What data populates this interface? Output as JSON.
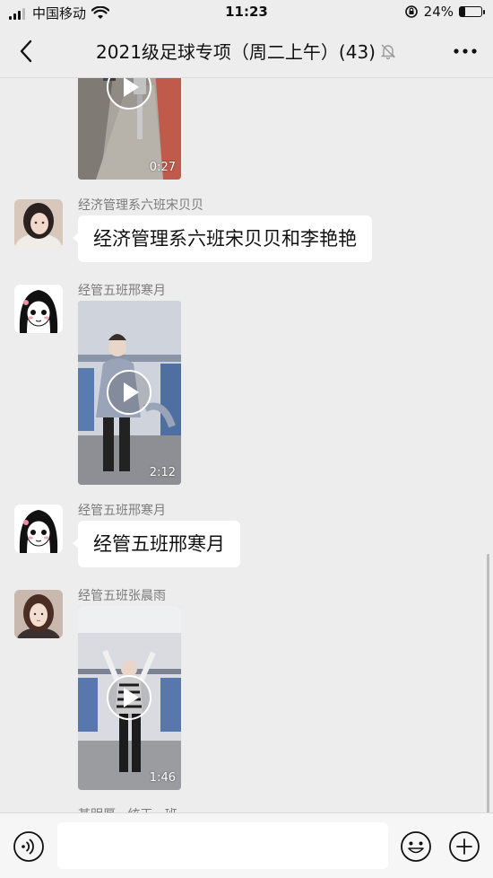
{
  "status_bar": {
    "carrier": "中国移动",
    "time": "11:23",
    "battery": "24%",
    "battery_level": 0.24,
    "icons": [
      "signal-icon",
      "wifi-icon",
      "rotation-lock-icon",
      "battery-icon"
    ]
  },
  "header": {
    "title": "2021级足球专项（周二上午）(43)",
    "icons": [
      "back-arrow-icon",
      "mute-bell-icon",
      "more-dots-icon"
    ]
  },
  "messages": [
    {
      "type": "video",
      "sender": "",
      "duration": "0:27"
    },
    {
      "type": "text",
      "sender": "经济管理系六班宋贝贝",
      "text": "经济管理系六班宋贝贝和李艳艳"
    },
    {
      "type": "video",
      "sender": "经管五班邢寒月",
      "duration": "2:12"
    },
    {
      "type": "text",
      "sender": "经管五班邢寒月",
      "text": "经管五班邢寒月"
    },
    {
      "type": "video",
      "sender": "经管五班张晨雨",
      "duration": "1:46"
    },
    {
      "type": "partial",
      "sender": "某明厚 · 统王 · 班"
    }
  ],
  "input_bar": {
    "placeholder": "",
    "icons": [
      "voice-icon",
      "emoji-icon",
      "plus-icon"
    ]
  },
  "colors": {
    "background": "#ededed",
    "bubble": "#ffffff",
    "sender_text": "#7a7a7a"
  }
}
